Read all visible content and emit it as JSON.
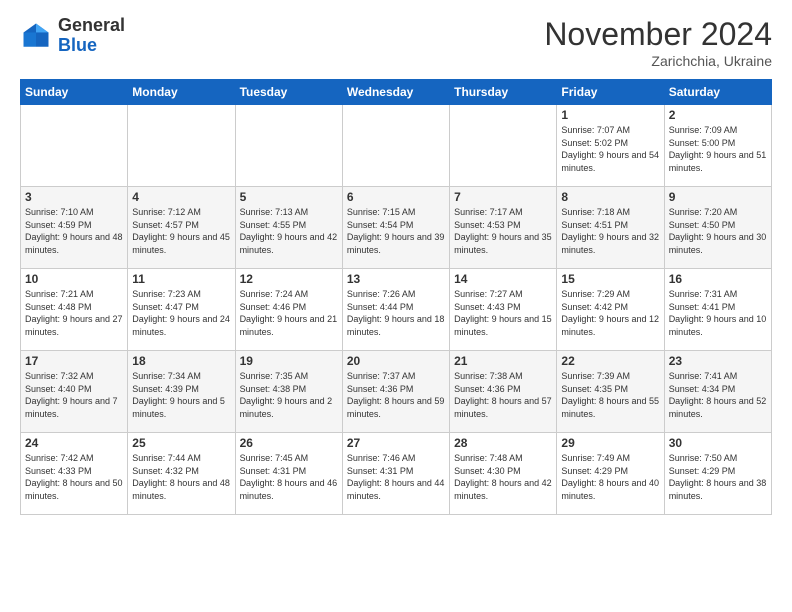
{
  "header": {
    "logo": {
      "line1": "General",
      "line2": "Blue"
    },
    "title": "November 2024",
    "location": "Zarichchia, Ukraine"
  },
  "weekdays": [
    "Sunday",
    "Monday",
    "Tuesday",
    "Wednesday",
    "Thursday",
    "Friday",
    "Saturday"
  ],
  "weeks": [
    [
      {
        "day": "",
        "info": ""
      },
      {
        "day": "",
        "info": ""
      },
      {
        "day": "",
        "info": ""
      },
      {
        "day": "",
        "info": ""
      },
      {
        "day": "",
        "info": ""
      },
      {
        "day": "1",
        "info": "Sunrise: 7:07 AM\nSunset: 5:02 PM\nDaylight: 9 hours and 54 minutes."
      },
      {
        "day": "2",
        "info": "Sunrise: 7:09 AM\nSunset: 5:00 PM\nDaylight: 9 hours and 51 minutes."
      }
    ],
    [
      {
        "day": "3",
        "info": "Sunrise: 7:10 AM\nSunset: 4:59 PM\nDaylight: 9 hours and 48 minutes."
      },
      {
        "day": "4",
        "info": "Sunrise: 7:12 AM\nSunset: 4:57 PM\nDaylight: 9 hours and 45 minutes."
      },
      {
        "day": "5",
        "info": "Sunrise: 7:13 AM\nSunset: 4:55 PM\nDaylight: 9 hours and 42 minutes."
      },
      {
        "day": "6",
        "info": "Sunrise: 7:15 AM\nSunset: 4:54 PM\nDaylight: 9 hours and 39 minutes."
      },
      {
        "day": "7",
        "info": "Sunrise: 7:17 AM\nSunset: 4:53 PM\nDaylight: 9 hours and 35 minutes."
      },
      {
        "day": "8",
        "info": "Sunrise: 7:18 AM\nSunset: 4:51 PM\nDaylight: 9 hours and 32 minutes."
      },
      {
        "day": "9",
        "info": "Sunrise: 7:20 AM\nSunset: 4:50 PM\nDaylight: 9 hours and 30 minutes."
      }
    ],
    [
      {
        "day": "10",
        "info": "Sunrise: 7:21 AM\nSunset: 4:48 PM\nDaylight: 9 hours and 27 minutes."
      },
      {
        "day": "11",
        "info": "Sunrise: 7:23 AM\nSunset: 4:47 PM\nDaylight: 9 hours and 24 minutes."
      },
      {
        "day": "12",
        "info": "Sunrise: 7:24 AM\nSunset: 4:46 PM\nDaylight: 9 hours and 21 minutes."
      },
      {
        "day": "13",
        "info": "Sunrise: 7:26 AM\nSunset: 4:44 PM\nDaylight: 9 hours and 18 minutes."
      },
      {
        "day": "14",
        "info": "Sunrise: 7:27 AM\nSunset: 4:43 PM\nDaylight: 9 hours and 15 minutes."
      },
      {
        "day": "15",
        "info": "Sunrise: 7:29 AM\nSunset: 4:42 PM\nDaylight: 9 hours and 12 minutes."
      },
      {
        "day": "16",
        "info": "Sunrise: 7:31 AM\nSunset: 4:41 PM\nDaylight: 9 hours and 10 minutes."
      }
    ],
    [
      {
        "day": "17",
        "info": "Sunrise: 7:32 AM\nSunset: 4:40 PM\nDaylight: 9 hours and 7 minutes."
      },
      {
        "day": "18",
        "info": "Sunrise: 7:34 AM\nSunset: 4:39 PM\nDaylight: 9 hours and 5 minutes."
      },
      {
        "day": "19",
        "info": "Sunrise: 7:35 AM\nSunset: 4:38 PM\nDaylight: 9 hours and 2 minutes."
      },
      {
        "day": "20",
        "info": "Sunrise: 7:37 AM\nSunset: 4:36 PM\nDaylight: 8 hours and 59 minutes."
      },
      {
        "day": "21",
        "info": "Sunrise: 7:38 AM\nSunset: 4:36 PM\nDaylight: 8 hours and 57 minutes."
      },
      {
        "day": "22",
        "info": "Sunrise: 7:39 AM\nSunset: 4:35 PM\nDaylight: 8 hours and 55 minutes."
      },
      {
        "day": "23",
        "info": "Sunrise: 7:41 AM\nSunset: 4:34 PM\nDaylight: 8 hours and 52 minutes."
      }
    ],
    [
      {
        "day": "24",
        "info": "Sunrise: 7:42 AM\nSunset: 4:33 PM\nDaylight: 8 hours and 50 minutes."
      },
      {
        "day": "25",
        "info": "Sunrise: 7:44 AM\nSunset: 4:32 PM\nDaylight: 8 hours and 48 minutes."
      },
      {
        "day": "26",
        "info": "Sunrise: 7:45 AM\nSunset: 4:31 PM\nDaylight: 8 hours and 46 minutes."
      },
      {
        "day": "27",
        "info": "Sunrise: 7:46 AM\nSunset: 4:31 PM\nDaylight: 8 hours and 44 minutes."
      },
      {
        "day": "28",
        "info": "Sunrise: 7:48 AM\nSunset: 4:30 PM\nDaylight: 8 hours and 42 minutes."
      },
      {
        "day": "29",
        "info": "Sunrise: 7:49 AM\nSunset: 4:29 PM\nDaylight: 8 hours and 40 minutes."
      },
      {
        "day": "30",
        "info": "Sunrise: 7:50 AM\nSunset: 4:29 PM\nDaylight: 8 hours and 38 minutes."
      }
    ]
  ]
}
